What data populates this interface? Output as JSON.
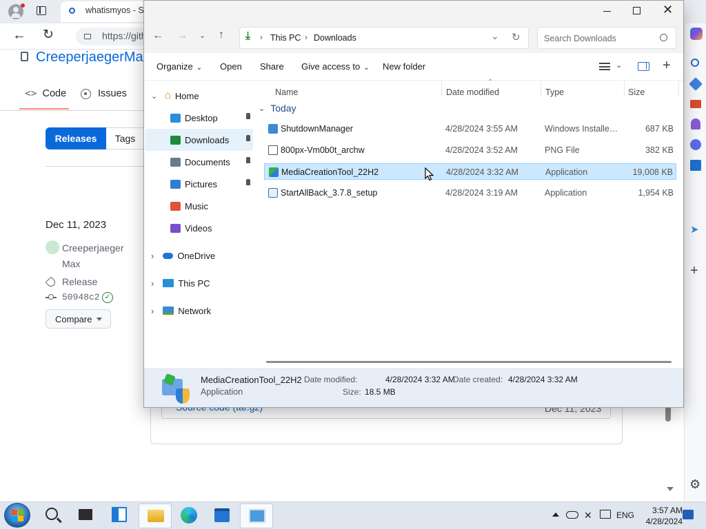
{
  "browser": {
    "tab_title": "whatismyos - Se",
    "url": "https://github.com/",
    "repo_owner": "CreeperjaegerMax",
    "tabs": [
      {
        "label": "Code",
        "icon": "code-icon"
      },
      {
        "label": "Issues",
        "icon": "issue-icon"
      }
    ],
    "releases_label": "Releases",
    "tags_label": "Tags",
    "release": {
      "date": "Dec 11, 2023",
      "author": "Creeperjaeger Max",
      "tag_label": "Release",
      "commit": "50948c2",
      "compare_label": "Compare"
    },
    "asset": {
      "name": "Source code (tar.gz)",
      "date": "Dec 11, 2023"
    }
  },
  "explorer": {
    "window_controls": [
      "minimize-icon",
      "maximize-icon",
      "close-icon"
    ],
    "breadcrumb": [
      "This PC",
      "Downloads"
    ],
    "search_placeholder": "Search Downloads",
    "commands": {
      "organize": "Organize",
      "open": "Open",
      "share": "Share",
      "give_access": "Give access to",
      "new_folder": "New folder"
    },
    "nav": {
      "home": "Home",
      "quick_access": [
        {
          "label": "Desktop",
          "icon": "desktop-icon"
        },
        {
          "label": "Downloads",
          "icon": "download-icon"
        },
        {
          "label": "Documents",
          "icon": "documents-icon"
        },
        {
          "label": "Pictures",
          "icon": "pictures-icon"
        },
        {
          "label": "Music",
          "icon": "music-icon"
        },
        {
          "label": "Videos",
          "icon": "videos-icon"
        }
      ],
      "onedrive": "OneDrive",
      "thispc": "This PC",
      "network": "Network"
    },
    "columns": {
      "name": "Name",
      "date": "Date modified",
      "type": "Type",
      "size": "Size"
    },
    "group_label": "Today",
    "files": [
      {
        "name": "ShutdownManager",
        "date": "4/28/2024 3:55 AM",
        "type": "Windows Installer ...",
        "size": "687 KB",
        "icon": "installer-icon"
      },
      {
        "name": "800px-Vm0b0t_archw",
        "date": "4/28/2024 3:52 AM",
        "type": "PNG File",
        "size": "382 KB",
        "icon": "image-file-icon"
      },
      {
        "name": "MediaCreationTool_22H2",
        "date": "4/28/2024 3:32 AM",
        "type": "Application",
        "size": "19,008 KB",
        "icon": "media-tool-icon"
      },
      {
        "name": "StartAllBack_3.7.8_setup",
        "date": "4/28/2024 3:19 AM",
        "type": "Application",
        "size": "1,954 KB",
        "icon": "setup-icon"
      }
    ],
    "selected_index": 2,
    "details": {
      "name": "MediaCreationTool_22H2",
      "kind": "Application",
      "modified_label": "Date modified:",
      "modified": "4/28/2024 3:32 AM",
      "created_label": "Date created:",
      "created": "4/28/2024 3:32 AM",
      "size_label": "Size:",
      "size": "18.5 MB"
    }
  },
  "taskbar": {
    "lang": "ENG",
    "time": "3:57 AM",
    "date": "4/28/2024"
  },
  "colors": {
    "accent": "#0969da",
    "selection": "#cce8ff",
    "taskbar": "#dfe6ef"
  }
}
